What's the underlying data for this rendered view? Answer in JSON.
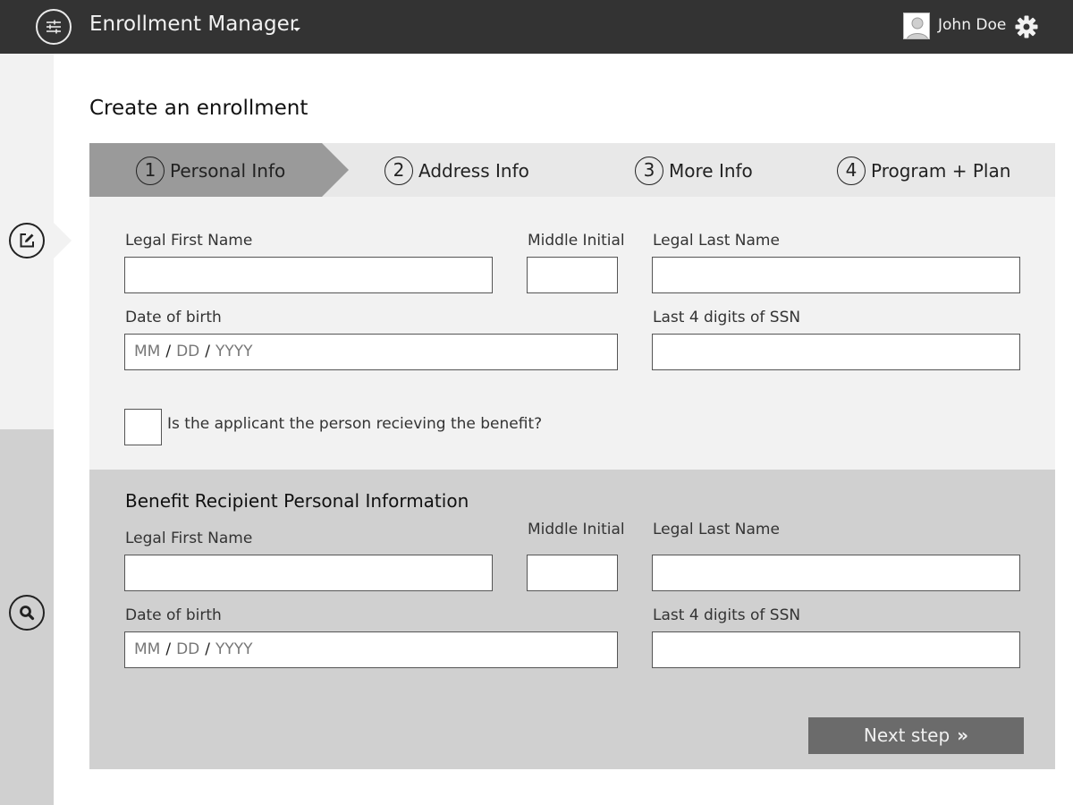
{
  "header": {
    "app_title": "Enrollment Manager",
    "user_name": "John Doe",
    "icons": {
      "menu": "sliders-icon",
      "dropdown": "caret-down-icon",
      "avatar": "user-avatar-icon",
      "settings": "gear-icon"
    }
  },
  "rail": {
    "icons": {
      "edit": "edit-icon",
      "search": "search-icon"
    }
  },
  "page": {
    "title": "Create an enrollment"
  },
  "stepper": {
    "steps": [
      {
        "number": "1",
        "label": "Personal Info",
        "active": true
      },
      {
        "number": "2",
        "label": "Address Info",
        "active": false
      },
      {
        "number": "3",
        "label": "More Info",
        "active": false
      },
      {
        "number": "4",
        "label": "Program + Plan",
        "active": false
      }
    ]
  },
  "applicant": {
    "first_name_label": "Legal First Name",
    "first_name_value": "",
    "middle_initial_label": "Middle Initial",
    "middle_initial_value": "",
    "last_name_label": "Legal Last Name",
    "last_name_value": "",
    "dob_label": "Date of birth",
    "dob_placeholder": {
      "mm": "MM",
      "dd": "DD",
      "yyyy": "YYYY",
      "sep": "/"
    },
    "ssn_label": "Last 4 digits of SSN",
    "ssn_value": "",
    "checkbox_label": "Is the applicant the person recieving the benefit?",
    "checkbox_checked": false
  },
  "recipient": {
    "section_title": "Benefit Recipient Personal Information",
    "first_name_label": "Legal First Name",
    "first_name_value": "",
    "middle_initial_label": "Middle Initial",
    "middle_initial_value": "",
    "last_name_label": "Legal Last Name",
    "last_name_value": "",
    "dob_label": "Date of birth",
    "dob_placeholder": {
      "mm": "MM",
      "dd": "DD",
      "yyyy": "YYYY",
      "sep": "/"
    },
    "ssn_label": "Last 4 digits of SSN",
    "ssn_value": ""
  },
  "actions": {
    "next_label": "Next step",
    "next_icon_glyph": "»"
  },
  "colors": {
    "topbar": "#333333",
    "active_step": "#9a9a9a",
    "stepper_bg": "#e8e8e8",
    "panel_light": "#f2f2f2",
    "panel_dark": "#d0d0d0",
    "button": "#6b6b6b"
  }
}
